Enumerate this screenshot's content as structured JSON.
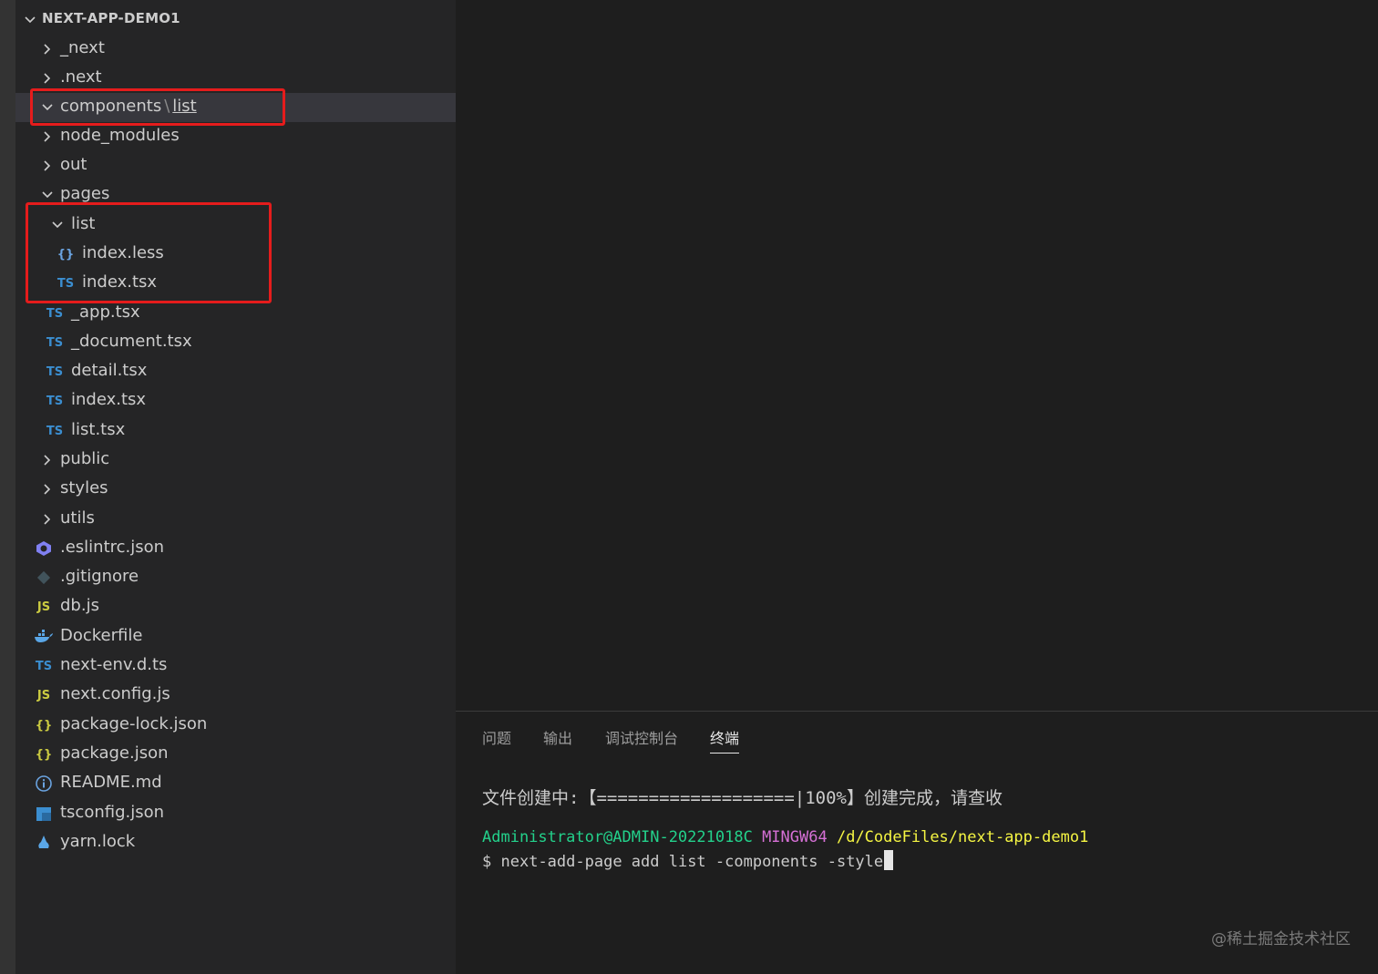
{
  "explorer": {
    "root_title": "NEXT-APP-DEMO1",
    "items": [
      {
        "label": "_next",
        "type": "folder",
        "expanded": false
      },
      {
        "label": ".next",
        "type": "folder",
        "expanded": false
      },
      {
        "label": "components",
        "type": "folder",
        "expanded": true,
        "compact_child": "list",
        "separator": "\\"
      },
      {
        "label": "node_modules",
        "type": "folder",
        "expanded": false
      },
      {
        "label": "out",
        "type": "folder",
        "expanded": false
      },
      {
        "label": "pages",
        "type": "folder",
        "expanded": true
      },
      {
        "label": "list",
        "type": "folder",
        "expanded": true
      },
      {
        "label": "index.less",
        "type": "file",
        "icon": "{}"
      },
      {
        "label": "index.tsx",
        "type": "file",
        "icon": "TS"
      },
      {
        "label": "_app.tsx",
        "type": "file",
        "icon": "TS"
      },
      {
        "label": "_document.tsx",
        "type": "file",
        "icon": "TS"
      },
      {
        "label": "detail.tsx",
        "type": "file",
        "icon": "TS"
      },
      {
        "label": "index.tsx",
        "type": "file",
        "icon": "TS"
      },
      {
        "label": "list.tsx",
        "type": "file",
        "icon": "TS"
      },
      {
        "label": "public",
        "type": "folder",
        "expanded": false
      },
      {
        "label": "styles",
        "type": "folder",
        "expanded": false
      },
      {
        "label": "utils",
        "type": "folder",
        "expanded": false
      },
      {
        "label": ".eslintrc.json",
        "type": "file",
        "icon": "eslint-icon"
      },
      {
        "label": ".gitignore",
        "type": "file",
        "icon": "git-icon"
      },
      {
        "label": "db.js",
        "type": "file",
        "icon": "JS"
      },
      {
        "label": "Dockerfile",
        "type": "file",
        "icon": "docker-icon"
      },
      {
        "label": "next-env.d.ts",
        "type": "file",
        "icon": "TS"
      },
      {
        "label": "next.config.js",
        "type": "file",
        "icon": "JS"
      },
      {
        "label": "package-lock.json",
        "type": "file",
        "icon": "{}"
      },
      {
        "label": "package.json",
        "type": "file",
        "icon": "{}"
      },
      {
        "label": "README.md",
        "type": "file",
        "icon": "info-icon"
      },
      {
        "label": "tsconfig.json",
        "type": "file",
        "icon": "tsconfig-icon"
      },
      {
        "label": "yarn.lock",
        "type": "file",
        "icon": "yarn-icon"
      }
    ]
  },
  "icons": {
    "ts": "TS",
    "js": "JS",
    "json": "{}",
    "less": "{}"
  },
  "panel": {
    "tabs": [
      {
        "label": "问题",
        "active": false
      },
      {
        "label": "输出",
        "active": false
      },
      {
        "label": "调试控制台",
        "active": false
      },
      {
        "label": "终端",
        "active": true
      }
    ],
    "terminal": {
      "progress_line": "文件创建中:【===================|100%】创建完成，请查收",
      "user_host": "Administrator@ADMIN-20221018C",
      "shell": "MINGW64",
      "path": "/d/CodeFiles/next-app-demo1",
      "prompt": "$",
      "command": "next-add-page add list -components -style"
    }
  },
  "watermark": "@稀土掘金技术社区",
  "colors": {
    "highlight_box": "#e51c1c",
    "ts_icon": "#3b8ed0",
    "js_icon": "#cbcb41",
    "terminal_green": "#23d18b",
    "terminal_magenta": "#d670d6",
    "terminal_yellow": "#f5f543"
  }
}
